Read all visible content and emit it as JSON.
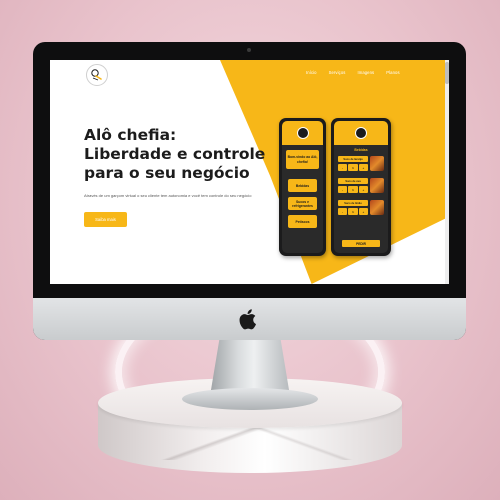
{
  "website": {
    "nav": [
      "Início",
      "Serviços",
      "Imagens",
      "Planos"
    ],
    "hero": {
      "title_lines": [
        "Alô chefia:",
        "Liberdade e controle",
        "para o seu negócio"
      ],
      "description": "Através de um garçom virtual o seu cliente tem autonomia e você tem controle do seu negócio",
      "cta_label": "Saiba mais"
    },
    "phone_left": {
      "greeting": "Bom-vindo ao Alô, chefia!",
      "buttons": [
        "Bebidas",
        "Sucos e refrigerantes",
        "Petiscos"
      ]
    },
    "phone_right": {
      "title": "Bebidas",
      "items": [
        "Suco de laranja",
        "Suco de uva",
        "Suco de limão"
      ],
      "controls": [
        "-",
        "1",
        "+"
      ],
      "order_label": "PEDIR"
    }
  },
  "colors": {
    "brand_yellow": "#f7b718",
    "phone_dark": "#1b1b1c",
    "background_pink": "#e9c3cc"
  },
  "icons": [
    "logo-icon",
    "apple-logo-icon"
  ]
}
